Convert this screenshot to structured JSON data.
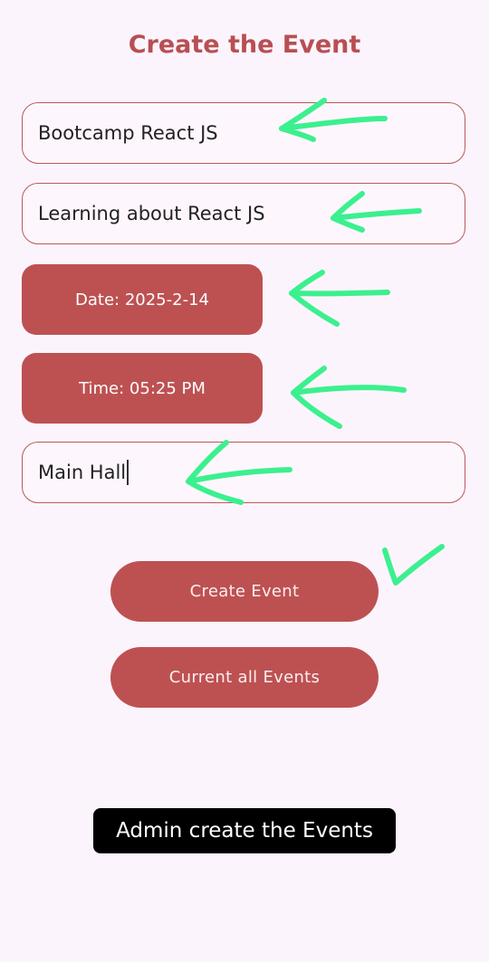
{
  "header": {
    "title": "Create the Event"
  },
  "form": {
    "event_name": "Bootcamp React JS",
    "description": "Learning about React JS",
    "date_button_label": "Date: 2025-2-14",
    "time_button_label": "Time: 05:25 PM",
    "location": "Main Hall"
  },
  "actions": {
    "create_label": "Create Event",
    "list_label": "Current all Events"
  },
  "caption": {
    "text": "Admin create the Events"
  },
  "colors": {
    "accent": "#bd5152",
    "background": "#fcf4fc",
    "annotation": "#3bf08e"
  },
  "annotations": {
    "arrow_icon": "left-arrow-icon",
    "check_icon": "checkmark-icon"
  }
}
